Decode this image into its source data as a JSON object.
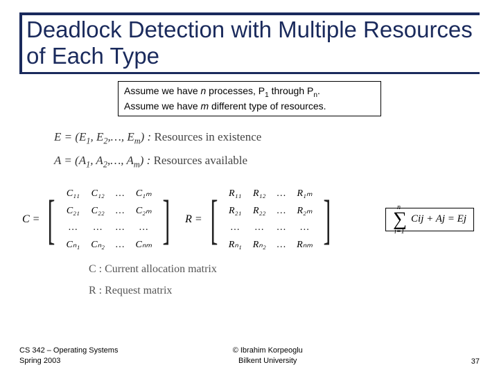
{
  "title": "Deadlock Detection with Multiple Resources of Each Type",
  "assume": {
    "line1_pre": "Assume we have ",
    "line1_n": "n",
    "line1_mid": " processes, P",
    "line1_sub1": "1",
    "line1_mid2": " through P",
    "line1_sub2": "n",
    "line1_end": ".",
    "line2_pre": "Assume we have ",
    "line2_m": "m",
    "line2_end": " different type of resources."
  },
  "vec": {
    "E_lhs": "E = (E",
    "E_s1": "1",
    "E_m1": ", E",
    "E_s2": "2",
    "E_m2": ",…, E",
    "E_sm": "m",
    "E_rhs": ") :",
    "E_lbl": " Resources in existence",
    "A_lhs": "A = (A",
    "A_s1": "1",
    "A_m1": ", A",
    "A_s2": "2",
    "A_m2": ",…, A",
    "A_sm": "m",
    "A_rhs": ") :",
    "A_lbl": " Resources available"
  },
  "matC": {
    "eq": "C =",
    "r1": [
      "C₁₁",
      "C₁₂",
      "…",
      "C₁ₘ"
    ],
    "r2": [
      "C₂₁",
      "C₂₂",
      "…",
      "C₂ₘ"
    ],
    "r3": [
      "…",
      "…",
      "…",
      "…"
    ],
    "r4": [
      "Cₙ₁",
      "Cₙ₂",
      "…",
      "Cₙₘ"
    ]
  },
  "matR": {
    "eq": "R =",
    "r1": [
      "R₁₁",
      "R₁₂",
      "…",
      "R₁ₘ"
    ],
    "r2": [
      "R₂₁",
      "R₂₂",
      "…",
      "R₂ₘ"
    ],
    "r3": [
      "…",
      "…",
      "…",
      "…"
    ],
    "r4": [
      "Rₙ₁",
      "Rₙ₂",
      "…",
      "Rₙₘ"
    ]
  },
  "sum": {
    "top": "n",
    "bot": "i=1",
    "body": "Cij + Aj = Ej"
  },
  "matlabels": {
    "c": "C : Current allocation matrix",
    "r": "R : Request matrix"
  },
  "footer": {
    "left1": "CS 342 – Operating Systems",
    "left2": "Spring 2003",
    "center1": "© Ibrahim Korpeoglu",
    "center2": "Bilkent University",
    "page": "37"
  }
}
